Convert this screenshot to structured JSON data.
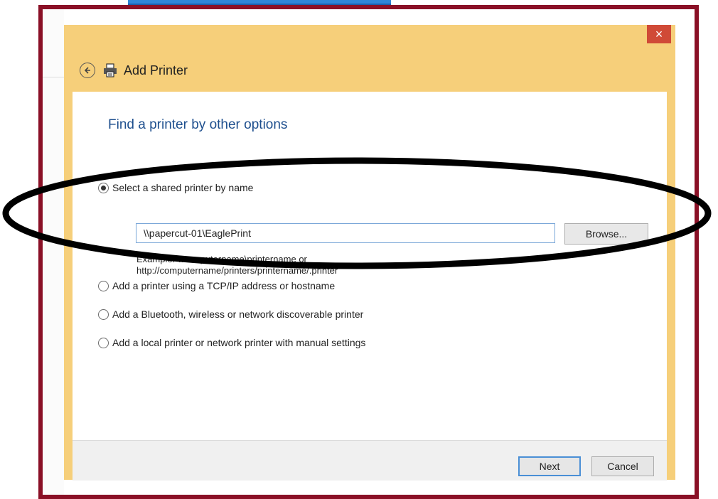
{
  "dialog": {
    "title": "Add Printer",
    "close_glyph": "×",
    "heading": "Find a printer by other options"
  },
  "options": [
    {
      "label": "Select a shared printer by name",
      "selected": true
    },
    {
      "label": "Add a printer using a TCP/IP address or hostname",
      "selected": false
    },
    {
      "label": "Add a Bluetooth, wireless or network discoverable printer",
      "selected": false
    },
    {
      "label": "Add a local printer or network printer with manual settings",
      "selected": false
    }
  ],
  "shared_printer": {
    "value": "\\\\papercut-01\\EaglePrint",
    "browse_label": "Browse...",
    "example_line1": "Example: \\\\computername\\printername or",
    "example_line2": "http://computername/printers/printername/.printer"
  },
  "footer": {
    "next_label": "Next",
    "cancel_label": "Cancel"
  },
  "colors": {
    "frame": "#8a1026",
    "dialog_chrome": "#f6cf7a",
    "close_button": "#d04a37",
    "heading": "#1e4f8e",
    "annotation": "#000000"
  },
  "icons": [
    "back-arrow-icon",
    "printer-icon",
    "close-icon",
    "radio-selected-icon",
    "radio-empty-icon"
  ]
}
